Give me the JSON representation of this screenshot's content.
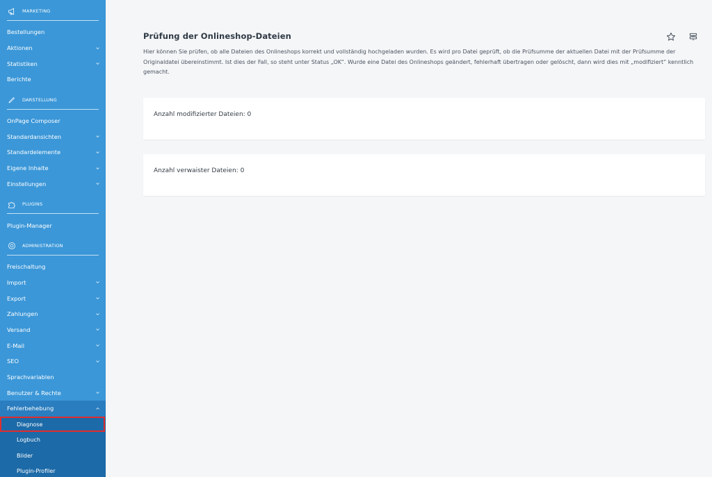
{
  "sidebar": {
    "sections": [
      {
        "id": "marketing",
        "title": "MARKETING",
        "icon": "megaphone-icon",
        "items": [
          {
            "label": "Bestellungen",
            "expandable": false
          },
          {
            "label": "Aktionen",
            "expandable": true
          },
          {
            "label": "Statistiken",
            "expandable": true
          },
          {
            "label": "Berichte",
            "expandable": false
          }
        ]
      },
      {
        "id": "darstellung",
        "title": "DARSTELLUNG",
        "icon": "pen-icon",
        "items": [
          {
            "label": "OnPage Composer",
            "expandable": false
          },
          {
            "label": "Standardansichten",
            "expandable": true
          },
          {
            "label": "Standardelemente",
            "expandable": true
          },
          {
            "label": "Eigene Inhalte",
            "expandable": true
          },
          {
            "label": "Einstellungen",
            "expandable": true
          }
        ]
      },
      {
        "id": "plugins",
        "title": "PLUGINS",
        "icon": "puzzle-icon",
        "items": [
          {
            "label": "Plugin-Manager",
            "expandable": false
          }
        ]
      },
      {
        "id": "administration",
        "title": "ADMINISTRATION",
        "icon": "gear-icon",
        "items": [
          {
            "label": "Freischaltung",
            "expandable": false
          },
          {
            "label": "Import",
            "expandable": true
          },
          {
            "label": "Export",
            "expandable": true
          },
          {
            "label": "Zahlungen",
            "expandable": true
          },
          {
            "label": "Versand",
            "expandable": true
          },
          {
            "label": "E-Mail",
            "expandable": true
          },
          {
            "label": "SEO",
            "expandable": true
          },
          {
            "label": "Sprachvariablen",
            "expandable": false
          },
          {
            "label": "Benutzer & Rechte",
            "expandable": true
          },
          {
            "label": "Fehlerbehebung",
            "expandable": true,
            "open": true
          }
        ]
      }
    ],
    "sub_items": [
      {
        "label": "Diagnose",
        "active": true
      },
      {
        "label": "Logbuch",
        "active": false
      },
      {
        "label": "Bilder",
        "active": false
      },
      {
        "label": "Plugin-Profiler",
        "active": false
      }
    ]
  },
  "main": {
    "title": "Prüfung der Onlineshop-Dateien",
    "description": "Hier können Sie prüfen, ob alle Dateien des Onlineshops korrekt und vollständig hochgeladen wurden. Es wird pro Datei geprüft, ob die Prüfsumme der aktuellen Datei mit der Prüfsumme der Originaldatei übereinstimmt. Ist dies der Fall, so steht unter Status „OK“. Wurde eine Datei des Onlineshops geändert, fehlerhaft übertragen oder gelöscht, dann wird dies mit „modifiziert“ kenntlich gemacht.",
    "cards": [
      {
        "text": "Anzahl modifizierter Dateien: 0"
      },
      {
        "text": "Anzahl verwaister Dateien: 0"
      }
    ],
    "icons": [
      "star-icon",
      "filter-settings-icon"
    ]
  },
  "colors": {
    "sidebar_bg": "#3b97d8",
    "sidebar_sub_bg": "#1c6aa8",
    "active_outline": "#e22d2d",
    "page_bg": "#f5f6f8"
  }
}
